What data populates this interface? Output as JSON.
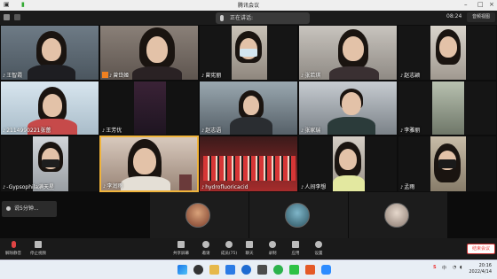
{
  "window": {
    "title": "腾讯会议"
  },
  "topbar": {
    "speaking": "正在讲话:",
    "timer": "08:24",
    "view_label": "音频视图"
  },
  "tiles": [
    {
      "name": "王智霞"
    },
    {
      "name": "曾岱姬"
    },
    {
      "name": "曾宪丽"
    },
    {
      "name": "张若琪"
    },
    {
      "name": "赵志颖"
    },
    {
      "name": "2114990221张蕾"
    },
    {
      "name": "王芳优"
    },
    {
      "name": "赵志语"
    },
    {
      "name": "张家瑞"
    },
    {
      "name": "李雅丽"
    },
    {
      "name": "-Gypsophila满天星"
    },
    {
      "name": "李润雨"
    },
    {
      "name": "hydrofluoricacid"
    },
    {
      "name": "人间李想"
    },
    {
      "name": "孟雨"
    }
  ],
  "strip": {
    "note": "说5分钟..."
  },
  "toolbar": {
    "mute": "解除静音",
    "video": "停止视频",
    "share": "共享屏幕",
    "members": "邀请",
    "manage": "成员(75)",
    "chat": "聊天",
    "record": "录制",
    "apps": "应用",
    "settings": "设置",
    "end": "结束会议"
  },
  "taskbar": {
    "time": "20:16",
    "date": "2022/4/14",
    "lang": "中"
  },
  "colors": {
    "active_border": "#f0b43c",
    "end_button": "#e44444"
  }
}
